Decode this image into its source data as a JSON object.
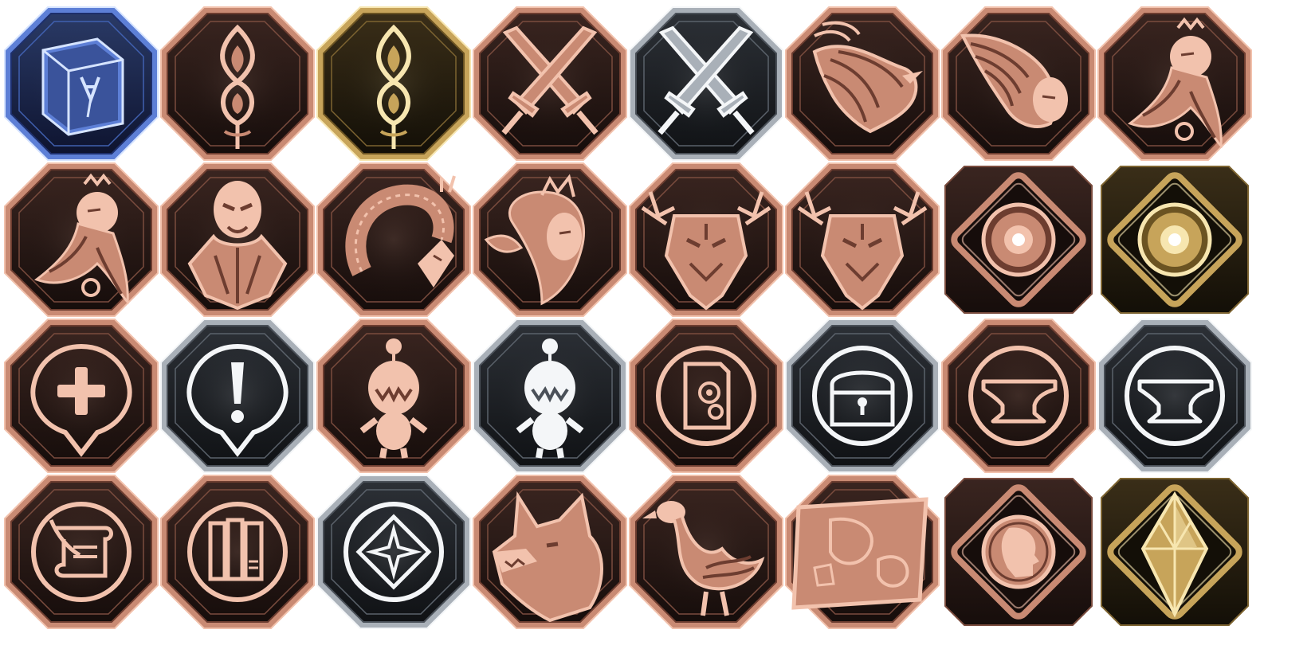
{
  "palettes": {
    "bronze": {
      "light": "#f2c2ad",
      "mid": "#c98a73",
      "dark": "#6d3d30",
      "bg1": "#3a2520",
      "bg2": "#160d0b",
      "line": "#7a4c3e"
    },
    "silver": {
      "light": "#f4f6f8",
      "mid": "#a9b0b8",
      "dark": "#4a5058",
      "bg1": "#2c3036",
      "bg2": "#101215",
      "line": "#5b626b"
    },
    "gold": {
      "light": "#f7e6b0",
      "mid": "#c7a45a",
      "dark": "#6b5322",
      "bg1": "#3a2e18",
      "bg2": "#130f07",
      "line": "#7d6431"
    },
    "blue": {
      "light": "#d6e4ff",
      "mid": "#5d7fd6",
      "dark": "#1e2f6b",
      "bg1": "#2a3a66",
      "bg2": "#0e1430",
      "line": "#4060b0"
    }
  },
  "badges": [
    {
      "icon": "book-icon",
      "tone": "blue",
      "frame": "octagon"
    },
    {
      "icon": "flame-icon",
      "tone": "bronze",
      "frame": "octagon"
    },
    {
      "icon": "flame-icon",
      "tone": "gold",
      "frame": "octagon"
    },
    {
      "icon": "crossed-swords-icon",
      "tone": "bronze",
      "frame": "octagon"
    },
    {
      "icon": "crossed-swords-icon",
      "tone": "silver",
      "frame": "octagon"
    },
    {
      "icon": "phoenix-icon",
      "tone": "bronze",
      "frame": "octagon"
    },
    {
      "icon": "garuda-icon",
      "tone": "bronze",
      "frame": "octagon"
    },
    {
      "icon": "bearded-sage-icon",
      "tone": "bronze",
      "frame": "octagon"
    },
    {
      "icon": "bearded-sage-icon",
      "tone": "bronze",
      "frame": "octagon"
    },
    {
      "icon": "horned-demon-icon",
      "tone": "bronze",
      "frame": "octagon"
    },
    {
      "icon": "serpent-icon",
      "tone": "bronze",
      "frame": "octagon"
    },
    {
      "icon": "crowned-woman-icon",
      "tone": "bronze",
      "frame": "octagon"
    },
    {
      "icon": "antlered-beast-icon",
      "tone": "bronze",
      "frame": "octagon"
    },
    {
      "icon": "antlered-beast-icon",
      "tone": "bronze",
      "frame": "octagon"
    },
    {
      "icon": "orb-icon",
      "tone": "bronze",
      "frame": "diamond"
    },
    {
      "icon": "orb-icon",
      "tone": "gold",
      "frame": "diamond"
    },
    {
      "icon": "plus-marker-icon",
      "tone": "bronze",
      "frame": "octagon"
    },
    {
      "icon": "exclamation-marker-icon",
      "tone": "silver",
      "frame": "octagon"
    },
    {
      "icon": "moogle-icon",
      "tone": "bronze",
      "frame": "octagon"
    },
    {
      "icon": "moogle-icon",
      "tone": "silver",
      "frame": "octagon"
    },
    {
      "icon": "card-icon",
      "tone": "bronze",
      "frame": "octagon"
    },
    {
      "icon": "treasure-chest-icon",
      "tone": "silver",
      "frame": "octagon"
    },
    {
      "icon": "anvil-icon",
      "tone": "bronze",
      "frame": "octagon"
    },
    {
      "icon": "anvil-icon",
      "tone": "silver",
      "frame": "octagon"
    },
    {
      "icon": "scroll-quill-icon",
      "tone": "bronze",
      "frame": "octagon"
    },
    {
      "icon": "books-icon",
      "tone": "bronze",
      "frame": "octagon"
    },
    {
      "icon": "star-diamond-icon",
      "tone": "silver",
      "frame": "octagon"
    },
    {
      "icon": "wolf-icon",
      "tone": "bronze",
      "frame": "octagon"
    },
    {
      "icon": "chocobo-icon",
      "tone": "bronze",
      "frame": "octagon"
    },
    {
      "icon": "map-icon",
      "tone": "bronze",
      "frame": "octagon"
    },
    {
      "icon": "coin-profile-icon",
      "tone": "bronze",
      "frame": "diamond"
    },
    {
      "icon": "crystal-icon",
      "tone": "gold",
      "frame": "diamond"
    }
  ]
}
